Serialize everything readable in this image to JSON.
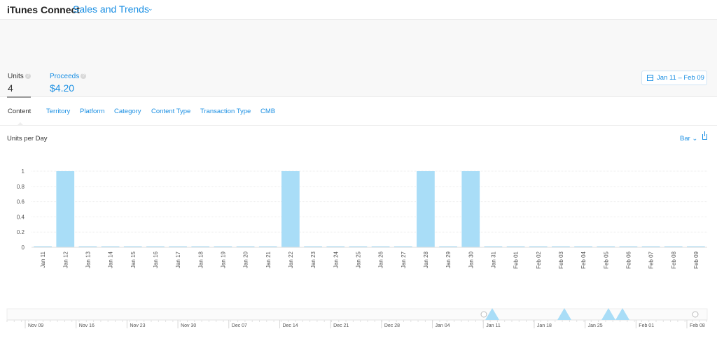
{
  "header": {
    "app_title": "iTunes Connect",
    "section": "Sales and Trends"
  },
  "metrics": {
    "units": {
      "label": "Units",
      "value": "4",
      "help": "?"
    },
    "proceeds": {
      "label": "Proceeds",
      "value": "$4.20",
      "help": "?"
    }
  },
  "date_range": "Jan 11 – Feb 09",
  "tabs": [
    "Content",
    "Territory",
    "Platform",
    "Category",
    "Content Type",
    "Transaction Type",
    "CMB"
  ],
  "chart": {
    "title": "Units per Day",
    "type_select": "Bar"
  },
  "colors": {
    "accent": "#1a8fe3",
    "bar": "#a9ddf7"
  },
  "chart_data": {
    "type": "bar",
    "title": "Units per Day",
    "categories": [
      "Jan 11",
      "Jan 12",
      "Jan 13",
      "Jan 14",
      "Jan 15",
      "Jan 16",
      "Jan 17",
      "Jan 18",
      "Jan 19",
      "Jan 20",
      "Jan 21",
      "Jan 22",
      "Jan 23",
      "Jan 24",
      "Jan 25",
      "Jan 26",
      "Jan 27",
      "Jan 28",
      "Jan 29",
      "Jan 30",
      "Jan 31",
      "Feb 01",
      "Feb 02",
      "Feb 03",
      "Feb 04",
      "Feb 05",
      "Feb 06",
      "Feb 07",
      "Feb 08",
      "Feb 09"
    ],
    "values": [
      0,
      1,
      0,
      0,
      0,
      0,
      0,
      0,
      0,
      0,
      0,
      1,
      0,
      0,
      0,
      0,
      0,
      1,
      0,
      1,
      0,
      0,
      0,
      0,
      0,
      0,
      0,
      0,
      0,
      0
    ],
    "ylim": [
      0,
      1
    ],
    "yticks": [
      "0",
      "0.2",
      "0.4",
      "0.6",
      "0.8",
      "1"
    ],
    "grid": true
  },
  "navigator": {
    "labels": [
      "Nov 09",
      "Nov 16",
      "Nov 23",
      "Nov 30",
      "Dec 07",
      "Dec 14",
      "Dec 21",
      "Dec 28",
      "Jan 04",
      "Jan 11",
      "Jan 18",
      "Jan 25",
      "Feb 01",
      "Feb 08"
    ],
    "markers": [
      "Jan 11",
      "Jan 21",
      "Jan 28",
      "Jan 30"
    ]
  }
}
